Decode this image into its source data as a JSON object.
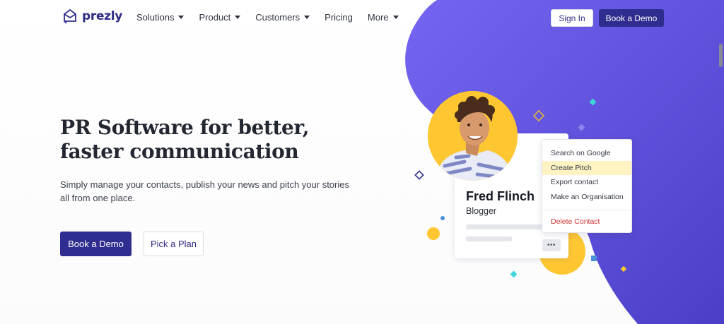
{
  "brand": {
    "name": "prezly",
    "color": "#2f2d8f"
  },
  "nav": {
    "items": [
      {
        "label": "Solutions",
        "dropdown": true
      },
      {
        "label": "Product",
        "dropdown": true
      },
      {
        "label": "Customers",
        "dropdown": true
      },
      {
        "label": "Pricing",
        "dropdown": false
      },
      {
        "label": "More",
        "dropdown": true
      }
    ],
    "signin_label": "Sign In",
    "demo_label": "Book a Demo"
  },
  "hero": {
    "title": "PR Software for better, faster communication",
    "subtitle": "Simply manage your contacts, publish your news and pitch your stories all from one place.",
    "primary_cta": "Book a Demo",
    "secondary_cta": "Pick a Plan"
  },
  "contact_card": {
    "name": "Fred Flinch",
    "role": "Blogger",
    "more_label": "•••"
  },
  "context_menu": {
    "items": [
      "Search on Google",
      "Create Pitch",
      "Export contact",
      "Make an Organisation"
    ],
    "highlighted": "Create Pitch",
    "danger_item": "Delete Contact"
  },
  "colors": {
    "blob": "#6a5ce6",
    "accent_yellow": "#fec732",
    "accent_cyan": "#3ed6d6",
    "highlight": "#fff3c4",
    "danger": "#d42e2e"
  }
}
